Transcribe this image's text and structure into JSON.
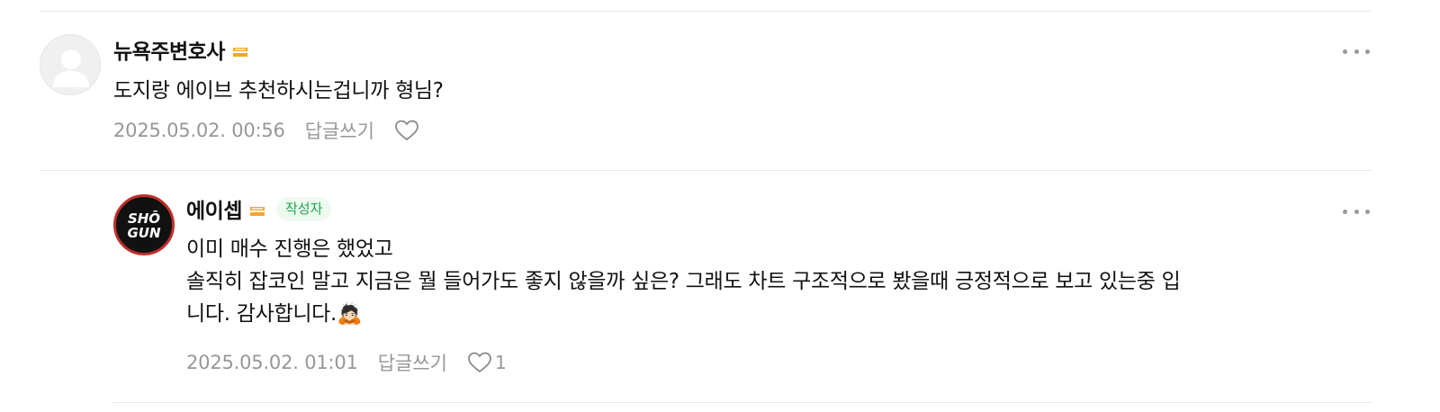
{
  "comments": [
    {
      "nickname": "뉴욕주변호사",
      "text_lines": [
        "도지랑 에이브 추천하시는겁니까 형님?"
      ],
      "date": "2025.05.02. 00:56",
      "reply_label": "답글쓰기",
      "like_count": ""
    },
    {
      "nickname": "에이셉",
      "author_badge": "작성자",
      "avatar_text_top": "SHŌ",
      "avatar_text_bottom": "GUN",
      "text_lines": [
        "이미 매수 진행은 했었고",
        "솔직히 잡코인 말고 지금은 뭘 들어가도 좋지 않을까 싶은? 그래도 차트 구조적으로 봤을때 긍정적으로 보고 있는중 입",
        "니다. 감사합니다.🙇🏻"
      ],
      "date": "2025.05.02. 01:01",
      "reply_label": "답글쓰기",
      "like_count": "1"
    }
  ]
}
